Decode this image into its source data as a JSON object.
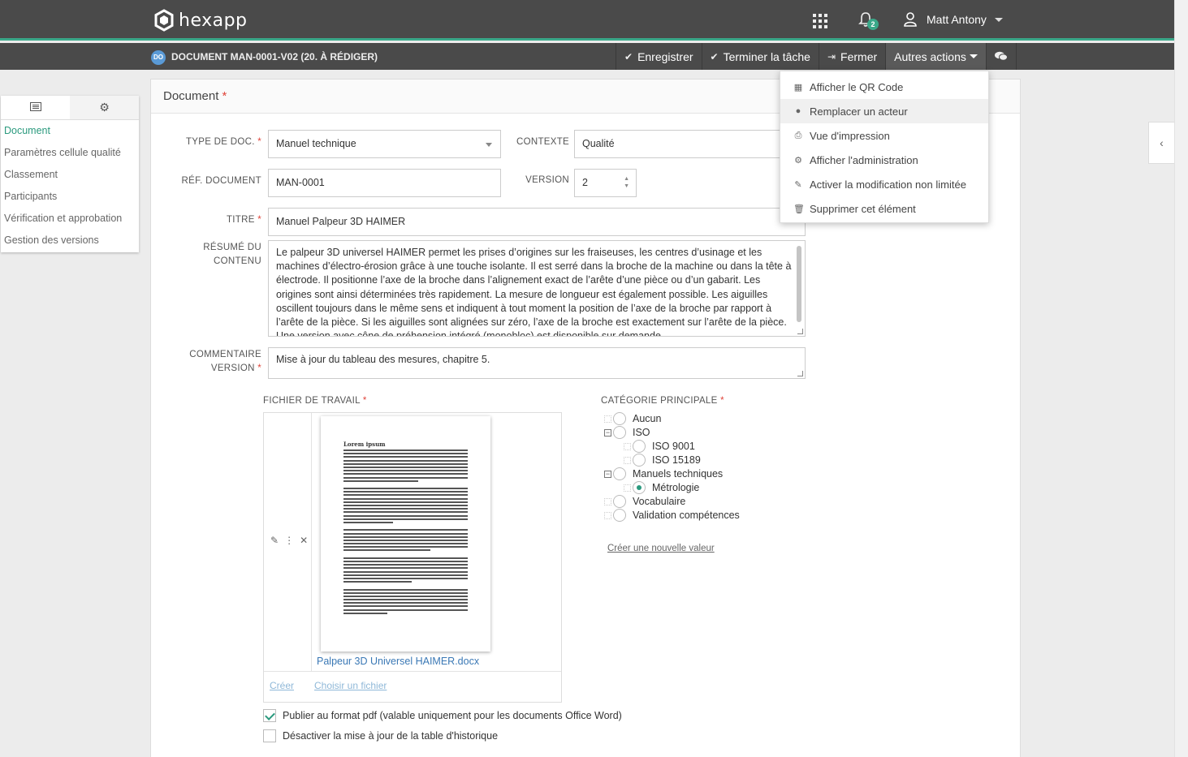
{
  "app": {
    "name": "hexapp"
  },
  "header": {
    "notifications_count": "2",
    "user_name": "Matt Antony"
  },
  "document_bar": {
    "badge": "DO",
    "title": "DOCUMENT MAN-0001-V02 (20. À RÉDIGER)",
    "actions": {
      "save": "Enregistrer",
      "finish_task": "Terminer la tâche",
      "close": "Fermer",
      "other_actions": "Autres actions"
    }
  },
  "dropdown": {
    "items": [
      {
        "label": "Afficher le QR Code",
        "icon": "qr-code-icon"
      },
      {
        "label": "Remplacer un acteur",
        "icon": "user-icon"
      },
      {
        "label": "Vue d'impression",
        "icon": "print-icon"
      },
      {
        "label": "Afficher l'administration",
        "icon": "gear-icon"
      },
      {
        "label": "Activer la modification non limitée",
        "icon": "edit-icon"
      },
      {
        "label": "Supprimer cet élément",
        "icon": "trash-icon"
      }
    ]
  },
  "sidebar": {
    "items": [
      {
        "label": "Document"
      },
      {
        "label": "Paramètres cellule qualité"
      },
      {
        "label": "Classement"
      },
      {
        "label": "Participants"
      },
      {
        "label": "Vérification et approbation"
      },
      {
        "label": "Gestion des versions"
      }
    ]
  },
  "form": {
    "section_title": "Document",
    "required_mark": "*",
    "doc_type": {
      "label": "TYPE DE DOC.",
      "value": "Manuel technique"
    },
    "context": {
      "label": "CONTEXTE",
      "value": "Qualité"
    },
    "reference": {
      "label": "RÉF. DOCUMENT",
      "value": "MAN-0001"
    },
    "version": {
      "label": "VERSION",
      "value": "2"
    },
    "title": {
      "label": "TITRE",
      "value": "Manuel Palpeur 3D HAIMER"
    },
    "summary": {
      "label_line1": "RÉSUMÉ DU",
      "label_line2": "CONTENU",
      "value": "Le palpeur 3D universel HAIMER permet les prises d’origines sur les fraiseuses, les centres d’usinage et les machines d’électro-érosion grâce à une touche isolante. Il est serré dans la broche de la machine ou dans la tête à électrode. Il positionne l’axe de la broche dans l’alignement exact de l’arête d’une pièce ou d’un gabarit. Les origines sont ainsi déterminées très rapidement. La mesure de longueur est également possible. Les aiguilles oscillent toujours dans le même sens et indiquent à tout moment la position de l’axe de la broche par rapport à l’arête de la pièce. Si les aiguilles sont alignées sur zéro, l’axe de la broche est exactement sur l’arête de la pièce. Une version avec cône de préhension intégré (monobloc) est disponible sur demande."
    },
    "version_comment": {
      "label_line1": "COMMENTAIRE",
      "label_line2": "VERSION",
      "value": "Mise à jour du tableau des mesures, chapitre 5."
    },
    "work_file": {
      "label": "FICHIER DE TRAVAIL",
      "preview_heading": "Lorem ipsum",
      "file_name": "Palpeur 3D Universel HAIMER.docx",
      "create": "Créer",
      "choose": "Choisir un fichier"
    },
    "main_category": {
      "label": "CATÉGORIE PRINCIPALE",
      "nodes": [
        {
          "label": "Aucun"
        },
        {
          "label": "ISO"
        },
        {
          "label": "ISO 9001"
        },
        {
          "label": "ISO 15189"
        },
        {
          "label": "Manuels techniques"
        },
        {
          "label": "Métrologie"
        },
        {
          "label": "Vocabulaire"
        },
        {
          "label": "Validation compétences"
        }
      ],
      "selected": "Métrologie",
      "create_new": "Créer une nouvelle valeur"
    },
    "publish_pdf": {
      "label": "Publier au format pdf (valable uniquement pour les documents Office Word)",
      "checked": true
    },
    "disable_history": {
      "label": "Désactiver la mise à jour de la table d'historique",
      "checked": false
    }
  },
  "colors": {
    "accent": "#2b9a7e",
    "topbar": "#4a4a4a",
    "link": "#3a78b5",
    "required": "#e0443a"
  }
}
